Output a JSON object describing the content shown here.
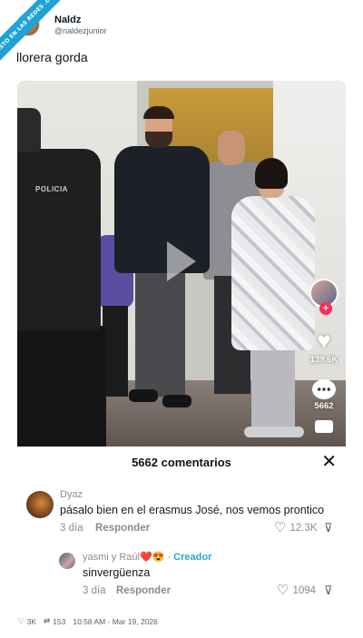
{
  "watermark": "VISTO EN LAS REDES .COM",
  "tweet": {
    "display_name": "Naldz",
    "handle": "@naldezjunior",
    "text": "llorera gorda",
    "likes": "3K",
    "retweets": "153",
    "timestamp": "10:58 AM - Mar 19, 2026"
  },
  "video": {
    "police_badge": "POLICIA",
    "likes": "139.6K",
    "comments": "5662",
    "icons": [
      "play-icon",
      "heart-icon",
      "comment-icon",
      "share-icon",
      "follow-plus-icon"
    ]
  },
  "comments_panel": {
    "title": "5662 comentarios",
    "close": "✕",
    "items": [
      {
        "user": "Dyaz",
        "text": "pásalo bien en el erasmus José, nos vemos prontico",
        "date": "3 día",
        "reply": "Responder",
        "likes": "12.3K"
      },
      {
        "user": "yasmi y Raúl",
        "user_emoji": "❤️😍",
        "separator": "·",
        "badge": "Creador",
        "text": "sinvergüenza",
        "date": "3 día",
        "reply": "Responder",
        "likes": "1094"
      }
    ]
  },
  "colors": {
    "accent": "#2da5c6",
    "tiktok_red": "#fe2c55",
    "ribbon": "#1fa2d6"
  }
}
